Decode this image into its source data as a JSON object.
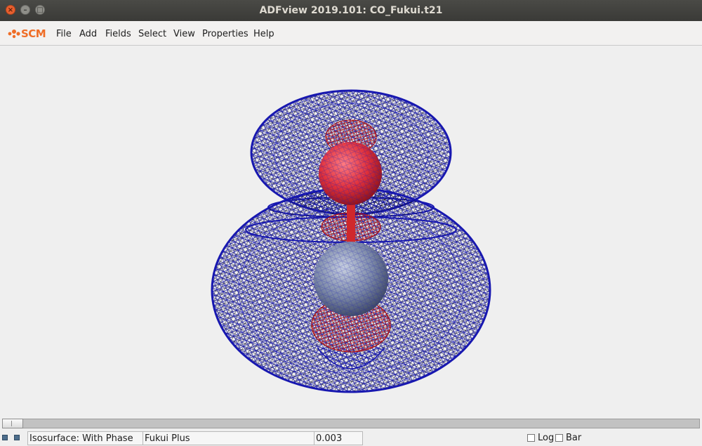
{
  "window": {
    "title": "ADFview 2019.101: CO_Fukui.t21",
    "close_icon": "×",
    "minimize_icon": "–",
    "maximize_icon": "□"
  },
  "logo": {
    "text": "SCM",
    "color": "#ef6d26"
  },
  "menu": [
    {
      "label": "File"
    },
    {
      "label": "Add"
    },
    {
      "label": "Fields"
    },
    {
      "label": "Select"
    },
    {
      "label": "View"
    },
    {
      "label": "Properties"
    },
    {
      "label": "Help"
    }
  ],
  "scene": {
    "description_icons": [
      "isosurface-mesh-blue",
      "isosurface-mesh-red",
      "oxygen-atom",
      "carbon-atom"
    ],
    "colors": {
      "positive_mesh": "#1010c8",
      "negative_mesh": "#cc1010",
      "oxygen": "#e0303a",
      "carbon": "#7d8aa8",
      "background": "#efefef"
    }
  },
  "statusbar": {
    "mode": "Isosurface: With Phase",
    "field": "Fukui Plus",
    "value": "0.003",
    "log_label": "Log",
    "log_checked": false,
    "bar_label": "Bar",
    "bar_checked": false
  }
}
